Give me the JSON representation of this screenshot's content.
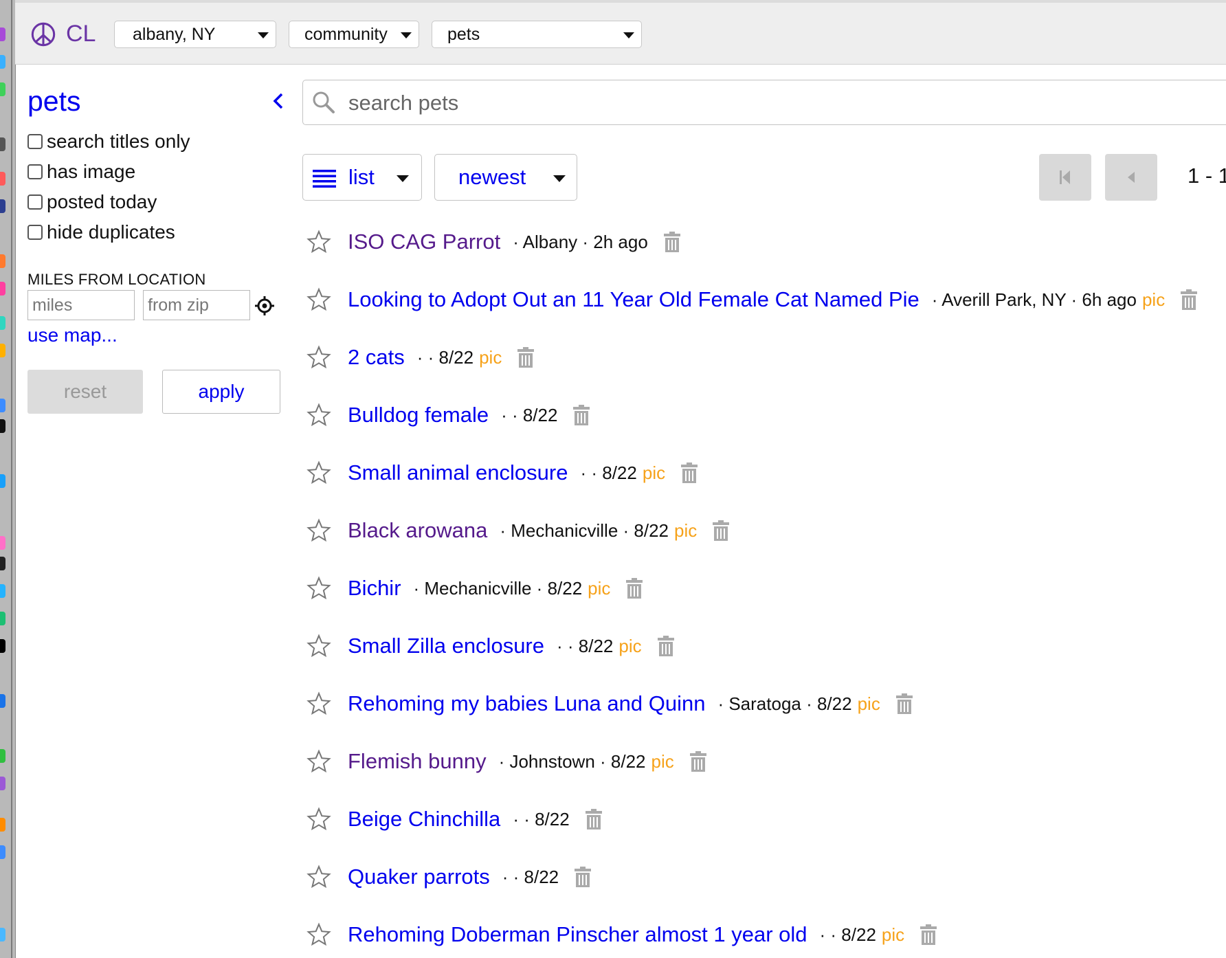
{
  "header": {
    "logo_text": "CL",
    "location": "albany, NY",
    "section": "community",
    "category": "pets",
    "colors": {
      "brand": "#6a34a5",
      "link": "#0000ee",
      "visited": "#551a8b",
      "pic": "#f6a21a"
    }
  },
  "sidebar": {
    "title": "pets",
    "checkboxes": [
      {
        "label": "search titles only",
        "checked": false
      },
      {
        "label": "has image",
        "checked": false
      },
      {
        "label": "posted today",
        "checked": false
      },
      {
        "label": "hide duplicates",
        "checked": false
      }
    ],
    "miles_label": "MILES FROM LOCATION",
    "miles_placeholder": "miles",
    "zip_placeholder": "from zip",
    "use_map": "use map...",
    "reset_label": "reset",
    "apply_label": "apply"
  },
  "search": {
    "placeholder": "search pets"
  },
  "toolbar": {
    "view_label": "list",
    "sort_label": "newest",
    "page_count": "1 - 1"
  },
  "listings": [
    {
      "title": "ISO CAG Parrot",
      "meta": "· Albany · 2h ago",
      "pic": "",
      "visited": true
    },
    {
      "title": "Looking to Adopt Out an 11 Year Old Female Cat Named Pie",
      "meta": "· Averill Park, NY · 6h ago",
      "pic": "pic",
      "visited": false
    },
    {
      "title": "2 cats",
      "meta": "· · 8/22",
      "pic": "pic",
      "visited": false
    },
    {
      "title": "Bulldog female",
      "meta": "· · 8/22",
      "pic": "",
      "visited": false
    },
    {
      "title": "Small animal enclosure",
      "meta": "· · 8/22",
      "pic": "pic",
      "visited": false
    },
    {
      "title": "Black arowana",
      "meta": "· Mechanicville · 8/22",
      "pic": "pic",
      "visited": true
    },
    {
      "title": "Bichir",
      "meta": "· Mechanicville · 8/22",
      "pic": "pic",
      "visited": false
    },
    {
      "title": "Small Zilla enclosure",
      "meta": "· · 8/22",
      "pic": "pic",
      "visited": false
    },
    {
      "title": "Rehoming my babies Luna and Quinn",
      "meta": "· Saratoga · 8/22",
      "pic": "pic",
      "visited": false
    },
    {
      "title": "Flemish bunny",
      "meta": "· Johnstown · 8/22",
      "pic": "pic",
      "visited": true
    },
    {
      "title": "Beige Chinchilla",
      "meta": "· · 8/22",
      "pic": "",
      "visited": false
    },
    {
      "title": "Quaker parrots",
      "meta": "· · 8/22",
      "pic": "",
      "visited": false
    },
    {
      "title": "Rehoming Doberman Pinscher almost 1 year old",
      "meta": "· · 8/22",
      "pic": "pic",
      "visited": false
    }
  ]
}
